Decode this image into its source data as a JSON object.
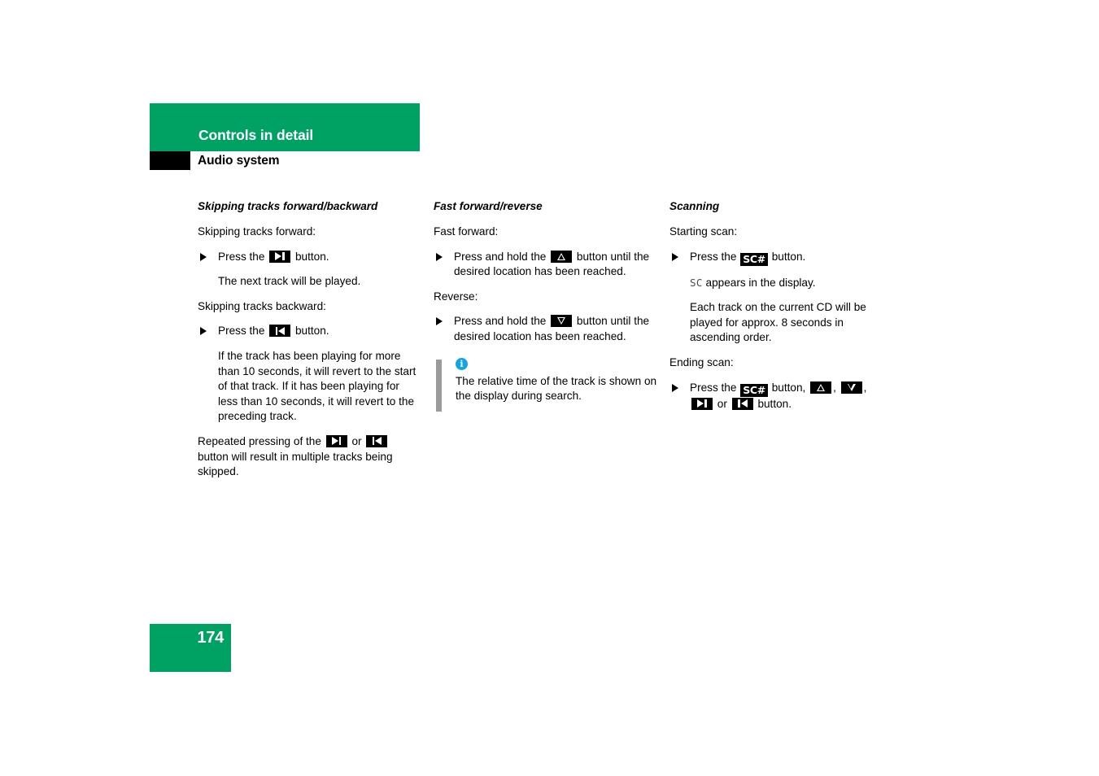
{
  "header": {
    "title": "Controls in detail",
    "subtitle": "Audio system"
  },
  "page_number": "174",
  "colors": {
    "brand_green": "#00a263",
    "info_blue": "#12a5e0",
    "note_bar_gray": "#9a9a9a",
    "key_black": "#000000"
  },
  "columns": [
    {
      "heading": "Skipping tracks forward/backward",
      "blocks": [
        {
          "kind": "para",
          "text": "Skipping tracks forward:"
        },
        {
          "kind": "bullet",
          "pre": "Press the",
          "icon": "next-track-icon",
          "post": "button."
        },
        {
          "kind": "indent",
          "text": "The next track will be played."
        },
        {
          "kind": "para",
          "text": "Skipping tracks backward:"
        },
        {
          "kind": "bullet",
          "pre": "Press the",
          "icon": "previous-track-icon",
          "post": "button."
        },
        {
          "kind": "indent",
          "text": "If the track has been playing for more than 10 seconds, it will revert to the start of that track. If it has been playing for less than 10 seconds, it will revert to the preceding track."
        },
        {
          "kind": "para-icons",
          "pre": "Repeated pressing of the",
          "icon1": "next-track-icon",
          "mid": "or",
          "icon2": "previous-track-icon",
          "post": "button will result in multiple tracks being skipped."
        }
      ]
    },
    {
      "heading": "Fast forward/reverse",
      "blocks": [
        {
          "kind": "para",
          "text": "Fast forward:"
        },
        {
          "kind": "bullet",
          "pre": "Press and hold the",
          "icon": "up-arrow-icon",
          "post": "button until the desired location has been reached."
        },
        {
          "kind": "para",
          "text": "Reverse:"
        },
        {
          "kind": "bullet",
          "pre": "Press and hold the",
          "icon": "down-arrow-icon",
          "post": "button until the desired location has been reached."
        },
        {
          "kind": "note",
          "icon": "info-icon",
          "text": "The relative time of the track is shown on the display during search."
        }
      ]
    },
    {
      "heading": "Scanning",
      "blocks": [
        {
          "kind": "para",
          "text": "Starting scan:"
        },
        {
          "kind": "bullet",
          "pre": "Press the",
          "icon": "sc-button-icon",
          "icon_label": "SC#",
          "post": "button."
        },
        {
          "kind": "indent-disp",
          "disp": "SC",
          "text": "appears in the display."
        },
        {
          "kind": "indent",
          "text": "Each track on the current CD will be played for approx. 8 seconds in ascending order."
        },
        {
          "kind": "para",
          "text": "Ending scan:"
        },
        {
          "kind": "bullet-multi",
          "pre": "Press the",
          "icon_label": "SC#",
          "post": "button."
        }
      ]
    }
  ],
  "labels": {
    "press_the": "Press the",
    "press_and_hold_the": "Press and hold the",
    "button": "button.",
    "button_until": "button until the desired location has been reached.",
    "or": "or",
    "sc_key": "SC#",
    "sc_display": "SC",
    "ending_scan_pre": "Press the",
    "ending_scan_mid": "button,",
    "ending_scan_post": "button."
  }
}
